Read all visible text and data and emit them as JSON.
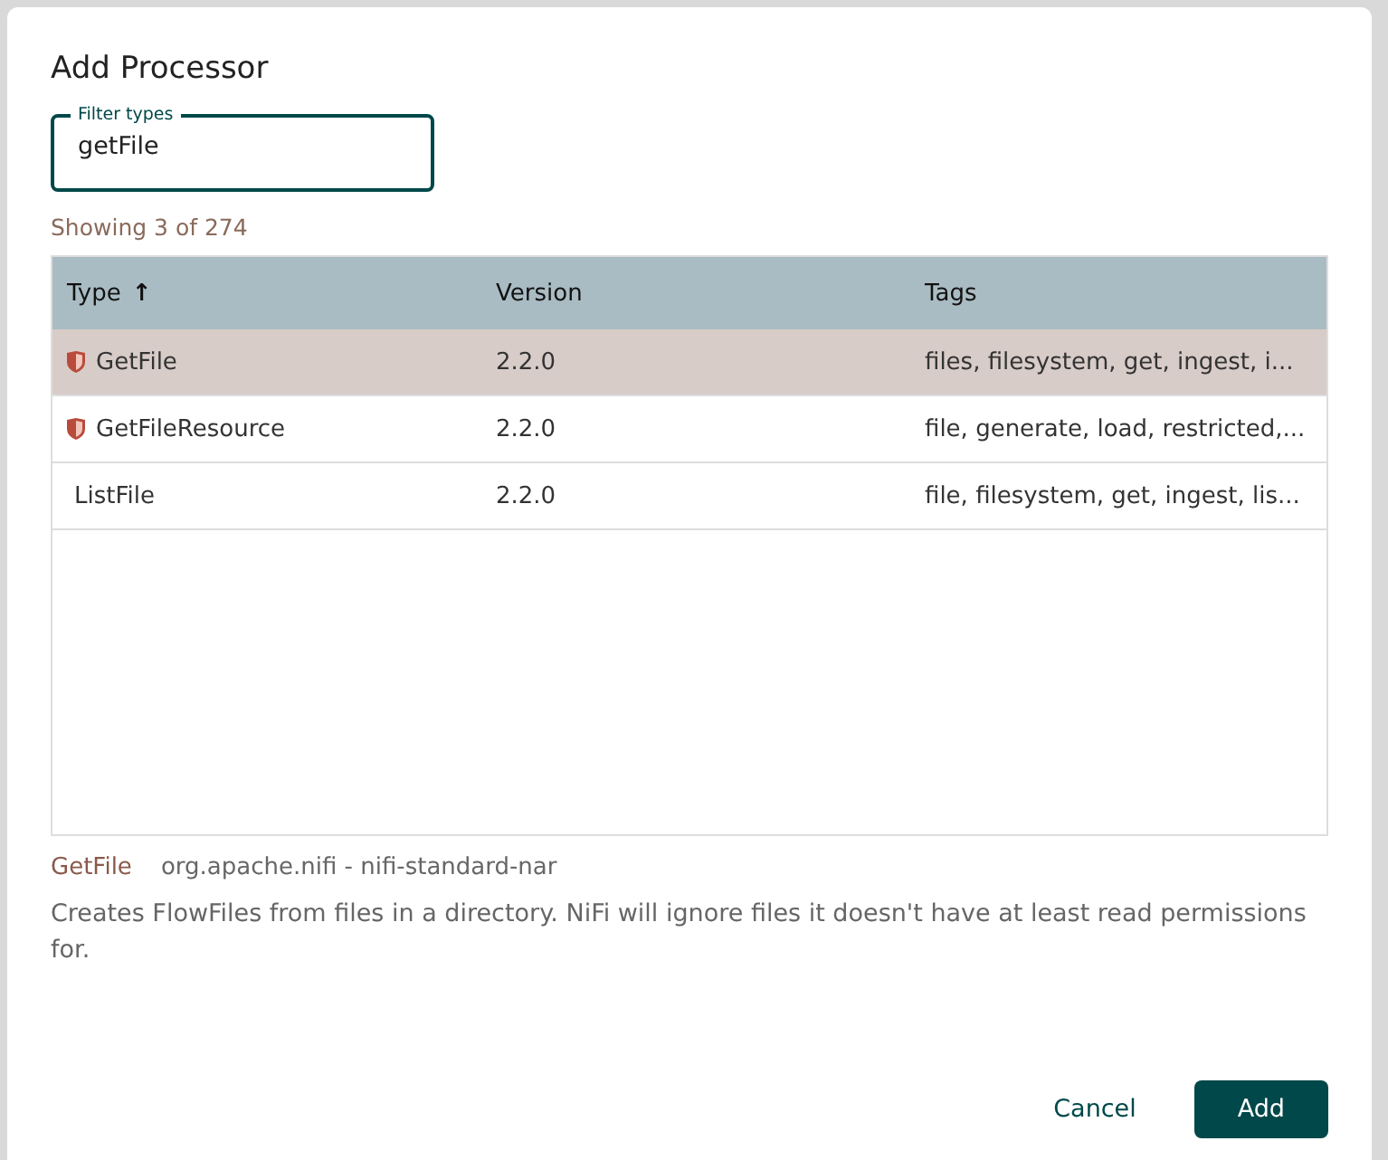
{
  "dialog": {
    "title": "Add Processor"
  },
  "filter": {
    "label": "Filter types",
    "value": "getFile"
  },
  "count": "Showing 3 of 274",
  "table": {
    "columns": [
      {
        "label": "Type",
        "sort": "↑"
      },
      {
        "label": "Version"
      },
      {
        "label": "Tags"
      }
    ],
    "rows": [
      {
        "type": "GetFile",
        "restricted": true,
        "version": "2.2.0",
        "tags": "files, filesystem, get, ingest, i...",
        "selected": true
      },
      {
        "type": "GetFileResource",
        "restricted": true,
        "version": "2.2.0",
        "tags": "file, generate, load, restricted,...",
        "selected": false
      },
      {
        "type": "ListFile",
        "restricted": false,
        "version": "2.2.0",
        "tags": "file, filesystem, get, ingest, lis...",
        "selected": false
      }
    ]
  },
  "details": {
    "name": "GetFile",
    "bundle": "org.apache.nifi - nifi-standard-nar",
    "description": "Creates FlowFiles from files in a directory. NiFi will ignore files it doesn't have at least read permissions for."
  },
  "buttons": [
    {
      "label": "Cancel",
      "kind": "text"
    },
    {
      "label": "Add",
      "kind": "primary"
    }
  ]
}
